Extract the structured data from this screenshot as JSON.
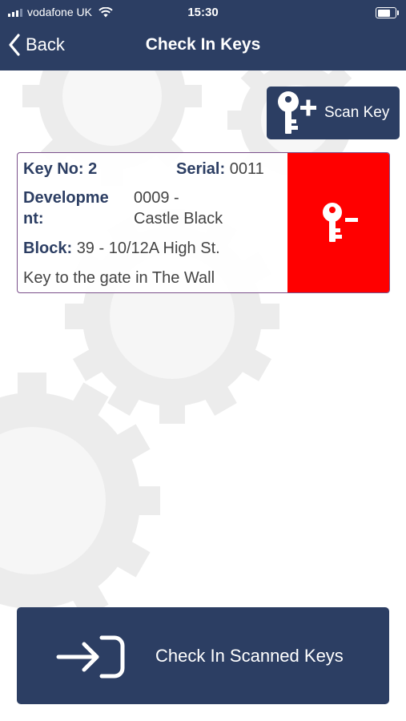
{
  "status": {
    "carrier": "vodafone UK",
    "time": "15:30",
    "signal_icon": "cellular-signal-icon",
    "wifi_icon": "wifi-icon",
    "battery_level": 0.85
  },
  "nav": {
    "back_label": "Back",
    "title": "Check In Keys"
  },
  "scan": {
    "label": "Scan Key",
    "icon": "key-plus-icon"
  },
  "keys": [
    {
      "key_no_label": "Key No:",
      "key_no": "2",
      "serial_label": "Serial:",
      "serial": "0011",
      "development_label_1": "Developme",
      "development_label_2": "nt:",
      "development_line_1": "0009 -",
      "development_line_2": "Castle Black",
      "block_label": "Block:",
      "block": "39 - 10/12A High St.",
      "description": "Key to the gate in The Wall",
      "remove_icon": "key-minus-icon",
      "remove_color": "#ff0000"
    }
  ],
  "footer": {
    "checkin_label": "Check In Scanned Keys",
    "checkin_icon": "sign-in-arrow-icon"
  },
  "colors": {
    "primary": "#2c3e63",
    "danger": "#ff0000"
  }
}
